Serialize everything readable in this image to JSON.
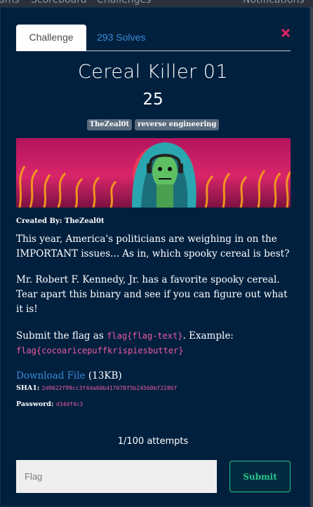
{
  "topbar": {
    "items": [
      "ams",
      "Scoreboard",
      "Challenges",
      "Notifications"
    ]
  },
  "tabs": {
    "challenge": "Challenge",
    "solves": "293 Solves"
  },
  "challenge": {
    "name": "Cereal Killer 01",
    "points": "25",
    "tags": [
      "TheZeal0t",
      "reverse engineering"
    ],
    "created_by": "Created By: TheZeal0t",
    "description": {
      "p1": "This year, America's politicians are weighing in on the IMPORTANT issues... As in, which spooky cereal is best?",
      "p2": "Mr. Robert F. Kennedy, Jr. has a favorite spooky cereal. Tear apart this binary and see if you can figure out what it is!",
      "p3_prefix": "Submit the flag as ",
      "p3_format": "flag{flag-text}",
      "p3_suffix": ". Example:",
      "p3_example": "flag{cocoaricepuffkrispiesbutter}"
    },
    "download": {
      "link_text": "Download File",
      "size": " (13KB)"
    },
    "sha1_label": "SHA1: ",
    "sha1_value": "2d9622f99cc3f4da60b417078f5b24560bf2286f",
    "password_label": "Password: ",
    "password_value": "d34df4c3"
  },
  "attempts": "1/100 attempts",
  "flag_input": {
    "placeholder": "Flag"
  },
  "submit_label": "Submit",
  "colors": {
    "modal_bg": "#01203e",
    "accent_link": "#3c8ad6",
    "code_pink": "#ec5ba4",
    "submit_green": "#27c48c",
    "close_red": "#e0245e"
  }
}
